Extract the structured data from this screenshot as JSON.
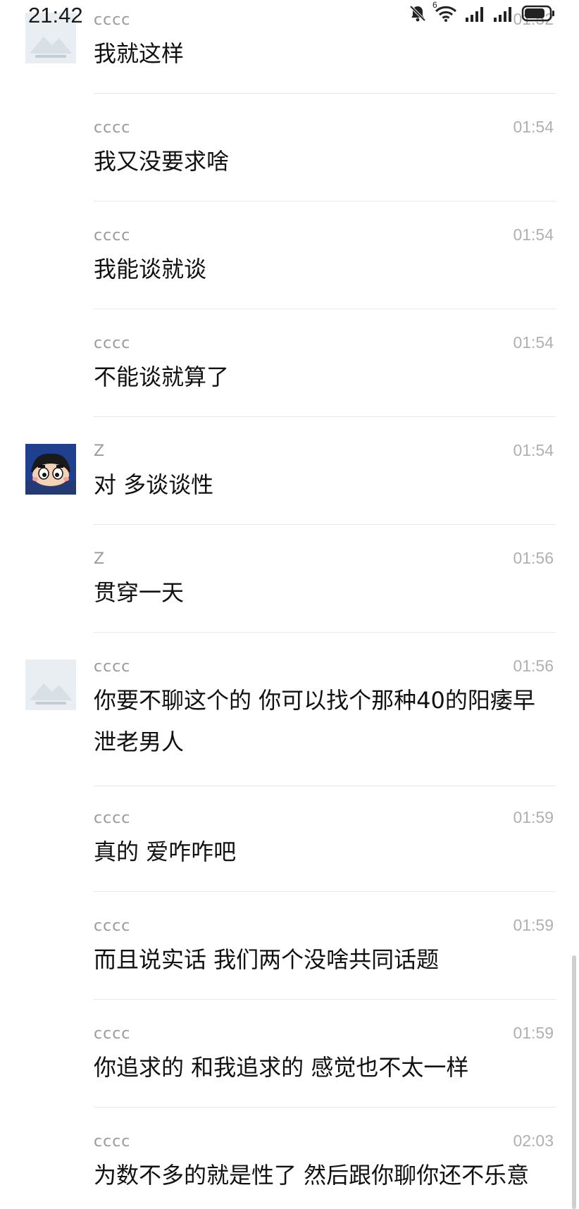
{
  "status_bar": {
    "time": "21:42",
    "icons": [
      "mute-bell-icon",
      "wifi-6-icon",
      "signal-icon",
      "signal-icon",
      "battery-icon"
    ],
    "wifi_badge": "6",
    "battery_level": "80"
  },
  "messages": [
    {
      "sender": "cccc",
      "time": "01:52",
      "text": "我就这样",
      "avatar": "placeholder-image"
    },
    {
      "sender": "cccc",
      "time": "01:54",
      "text": "我又没要求啥",
      "avatar": null
    },
    {
      "sender": "cccc",
      "time": "01:54",
      "text": "我能谈就谈",
      "avatar": null
    },
    {
      "sender": "cccc",
      "time": "01:54",
      "text": "不能谈就算了",
      "avatar": null
    },
    {
      "sender": "Z",
      "time": "01:54",
      "text": "对 多谈谈性",
      "avatar": "cartoon-boy"
    },
    {
      "sender": "Z",
      "time": "01:56",
      "text": "贯穿一天",
      "avatar": null
    },
    {
      "sender": "cccc",
      "time": "01:56",
      "text": "你要不聊这个的 你可以找个那种40的阳痿早泄老男人",
      "avatar": "placeholder-image"
    },
    {
      "sender": "cccc",
      "time": "01:59",
      "text": "真的 爱咋咋吧",
      "avatar": null
    },
    {
      "sender": "cccc",
      "time": "01:59",
      "text": "而且说实话 我们两个没啥共同话题",
      "avatar": null
    },
    {
      "sender": "cccc",
      "time": "01:59",
      "text": "你追求的 和我追求的 感觉也不太一样",
      "avatar": null
    },
    {
      "sender": "cccc",
      "time": "02:03",
      "text": "为数不多的就是性了 然后跟你聊你还不乐意",
      "avatar": null
    }
  ]
}
